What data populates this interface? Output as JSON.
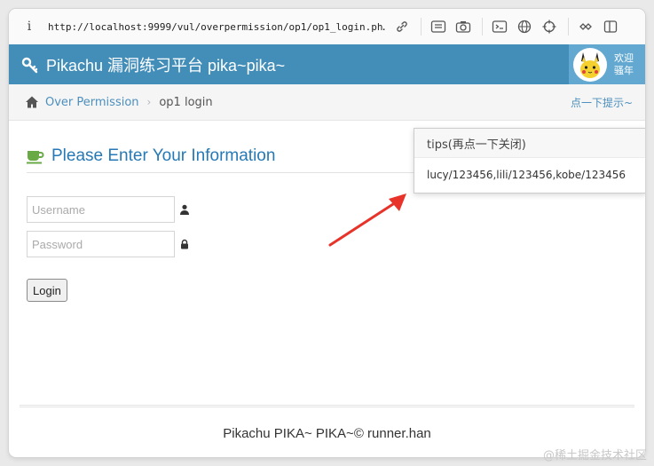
{
  "browser": {
    "url": "http://localhost:9999/vul/overpermission/op1/op1_login.ph…",
    "info_glyph": "i",
    "toolbar_icons": [
      "link-icon",
      "reader-icon",
      "camera-icon",
      "terminal-icon",
      "globe-icon",
      "crosshair-icon",
      "extensions-icon",
      "sidebar-icon"
    ]
  },
  "header": {
    "title": "Pikachu 漏洞练习平台 pika~pika~",
    "welcome_line1": "欢迎",
    "welcome_line2": "骚年",
    "bg_color": "#438eb9"
  },
  "breadcrumb": {
    "link": "Over Permission",
    "current": "op1 login",
    "tips_toggle": "点一下提示~"
  },
  "main": {
    "heading": "Please Enter Your Information",
    "username_placeholder": "Username",
    "password_placeholder": "Password",
    "login_label": "Login"
  },
  "popover": {
    "title": "tips(再点一下关闭)",
    "content": "lucy/123456,lili/123456,kobe/123456"
  },
  "footer": {
    "text": "Pikachu PIKA~ PIKA~© runner.han"
  },
  "watermark": "@稀土掘金技术社区"
}
